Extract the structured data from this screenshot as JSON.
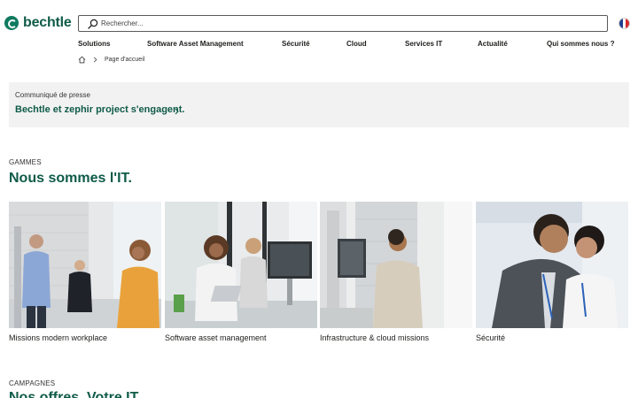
{
  "brand": {
    "name": "bechtle",
    "color": "#0f5b48"
  },
  "search": {
    "placeholder": "Rechercher..."
  },
  "nav": {
    "items": [
      {
        "label": "Solutions"
      },
      {
        "label": "Software Asset Management"
      },
      {
        "label": "Sécurité"
      },
      {
        "label": "Cloud"
      },
      {
        "label": "Services IT"
      },
      {
        "label": "Actualité"
      },
      {
        "label": "Qui sommes nous ?"
      }
    ]
  },
  "breadcrumb": {
    "home_icon": "home-icon",
    "current": "Page d'accueil"
  },
  "press": {
    "kicker": "Communiqué de presse",
    "title": "Bechtle et zephir project s'engagent."
  },
  "ranges": {
    "kicker": "GAMMES",
    "title": "Nous sommes l'IT.",
    "cards": [
      {
        "caption": "Missions modern workplace"
      },
      {
        "caption": "Software asset management"
      },
      {
        "caption": "Infrastructure & cloud missions"
      },
      {
        "caption": "Sécurité"
      }
    ]
  },
  "campaigns": {
    "kicker": "CAMPAGNES",
    "title": "Nos offres. Votre IT."
  },
  "colors": {
    "accent": "#0f5b48",
    "panel": "#f2f2f2",
    "text": "#1d1d1b"
  }
}
